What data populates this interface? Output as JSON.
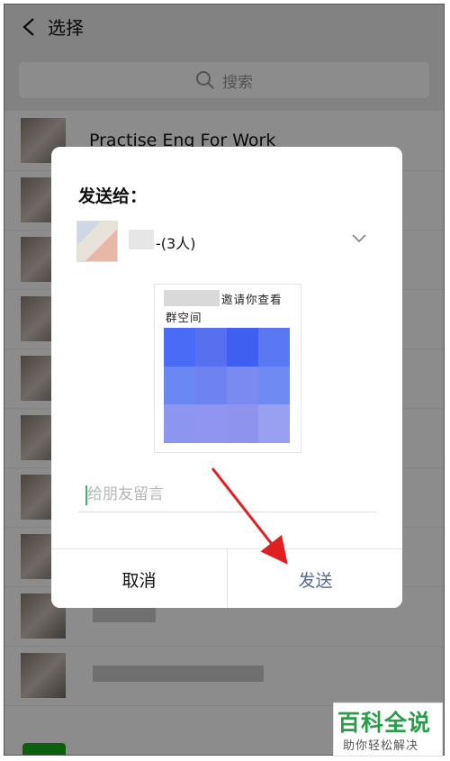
{
  "header": {
    "title": "选择"
  },
  "search": {
    "placeholder": "搜索"
  },
  "list": {
    "first_item": "Practise Eng For Work"
  },
  "dialog": {
    "title": "发送给：",
    "recipient_name": "-(3人)",
    "card": {
      "text_line1": "邀请你查看",
      "text_line2": "群空间"
    },
    "message_placeholder": "给朋友留言",
    "cancel_label": "取消",
    "send_label": "发送"
  },
  "watermark": {
    "title": "百科全说",
    "subtitle": "助你轻松解决"
  },
  "colors": {
    "accent_green": "#1aad19",
    "send_blue": "#576b95",
    "arrow_red": "#e02020"
  },
  "icons": {
    "back": "back-arrow-icon",
    "search": "search-icon",
    "chevron": "chevron-down-icon"
  }
}
